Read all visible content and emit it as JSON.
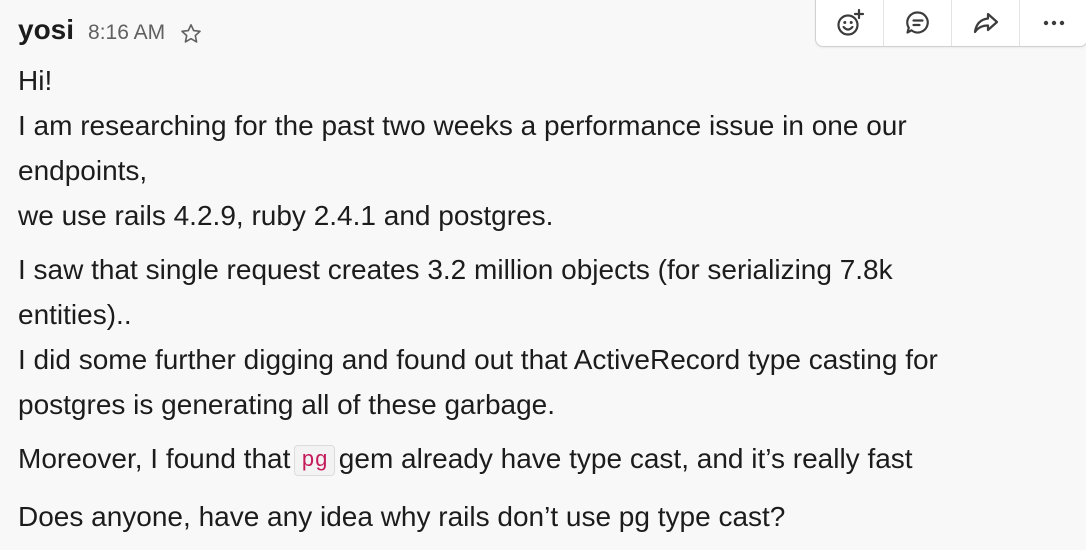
{
  "message": {
    "author": "yosi",
    "time": "8:16 AM",
    "paragraphs": [
      {
        "lines": [
          "Hi!",
          "I am researching for the past two weeks a performance issue in one our",
          "endpoints,",
          "we use rails 4.2.9, ruby 2.4.1 and postgres."
        ]
      },
      {
        "lines": [
          "I saw that single request creates 3.2 million objects (for serializing 7.8k",
          "entities)..",
          "I did some further digging and found out that ActiveRecord type casting for",
          "postgres is generating all of these garbage."
        ]
      },
      {
        "before_code": "Moreover, I found that",
        "code": "pg",
        "after_code": "gem already have type cast, and it’s really fast"
      },
      {
        "lines": [
          "Does anyone, have any idea why rails don’t use pg type cast?"
        ]
      }
    ]
  },
  "actions": {
    "items": [
      {
        "icon": "add-reaction-icon"
      },
      {
        "icon": "reply-thread-icon"
      },
      {
        "icon": "share-icon"
      },
      {
        "icon": "more-actions-icon"
      }
    ]
  },
  "colors": {
    "background": "#f8f8f8",
    "text": "#1d1c1d",
    "muted": "#616061",
    "code_text": "#c41a5a"
  }
}
